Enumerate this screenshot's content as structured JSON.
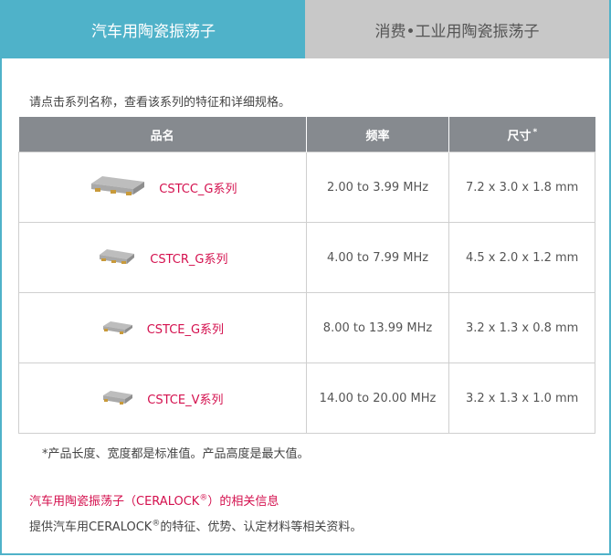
{
  "tabs": [
    {
      "label": "汽车用陶瓷振荡子",
      "active": true
    },
    {
      "label": "消费•工业用陶瓷振荡子",
      "active": false
    }
  ],
  "intro_text": "请点击系列名称，查看该系列的特征和详细规格。",
  "table": {
    "headers": {
      "name": "品名",
      "freq": "频率",
      "size": "尺寸",
      "size_mark": "*"
    },
    "rows": [
      {
        "series": "CSTCC_G系列",
        "freq": "2.00 to 3.99 MHz",
        "size": "7.2 x 3.0 x 1.8 mm"
      },
      {
        "series": "CSTCR_G系列",
        "freq": "4.00 to 7.99 MHz",
        "size": "4.5 x 2.0 x 1.2 mm"
      },
      {
        "series": "CSTCE_G系列",
        "freq": "8.00 to 13.99 MHz",
        "size": "3.2 x 1.3 x 0.8 mm"
      },
      {
        "series": "CSTCE_V系列",
        "freq": "14.00 to 20.00 MHz",
        "size": "3.2 x 1.3 x 1.0 mm"
      }
    ]
  },
  "note": "*产品长度、宽度都是标准值。产品高度是最大值。",
  "related": {
    "link_before": "汽车用陶瓷振荡子（CERALOCK",
    "link_reg": "®",
    "link_after": "）的相关信息",
    "desc_before": "提供汽车用CERALOCK",
    "desc_reg": "®",
    "desc_after": "的特征、优势、认定材料等相关资料。"
  },
  "colors": {
    "accent": "#4fb2c9",
    "header_bg": "#868a8f",
    "link": "#d4104e",
    "tab_inactive": "#c8c8c8"
  },
  "icons": [
    "ceramic-resonator-chip-image"
  ]
}
